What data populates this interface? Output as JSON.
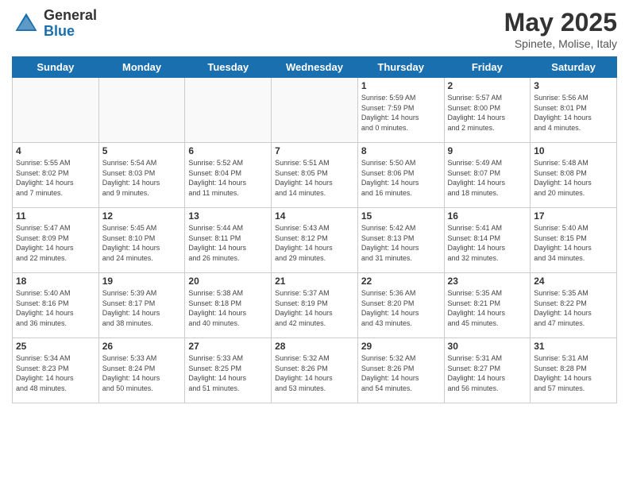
{
  "logo": {
    "general": "General",
    "blue": "Blue"
  },
  "title": "May 2025",
  "subtitle": "Spinete, Molise, Italy",
  "headers": [
    "Sunday",
    "Monday",
    "Tuesday",
    "Wednesday",
    "Thursday",
    "Friday",
    "Saturday"
  ],
  "weeks": [
    [
      {
        "day": "",
        "info": ""
      },
      {
        "day": "",
        "info": ""
      },
      {
        "day": "",
        "info": ""
      },
      {
        "day": "",
        "info": ""
      },
      {
        "day": "1",
        "info": "Sunrise: 5:59 AM\nSunset: 7:59 PM\nDaylight: 14 hours\nand 0 minutes."
      },
      {
        "day": "2",
        "info": "Sunrise: 5:57 AM\nSunset: 8:00 PM\nDaylight: 14 hours\nand 2 minutes."
      },
      {
        "day": "3",
        "info": "Sunrise: 5:56 AM\nSunset: 8:01 PM\nDaylight: 14 hours\nand 4 minutes."
      }
    ],
    [
      {
        "day": "4",
        "info": "Sunrise: 5:55 AM\nSunset: 8:02 PM\nDaylight: 14 hours\nand 7 minutes."
      },
      {
        "day": "5",
        "info": "Sunrise: 5:54 AM\nSunset: 8:03 PM\nDaylight: 14 hours\nand 9 minutes."
      },
      {
        "day": "6",
        "info": "Sunrise: 5:52 AM\nSunset: 8:04 PM\nDaylight: 14 hours\nand 11 minutes."
      },
      {
        "day": "7",
        "info": "Sunrise: 5:51 AM\nSunset: 8:05 PM\nDaylight: 14 hours\nand 14 minutes."
      },
      {
        "day": "8",
        "info": "Sunrise: 5:50 AM\nSunset: 8:06 PM\nDaylight: 14 hours\nand 16 minutes."
      },
      {
        "day": "9",
        "info": "Sunrise: 5:49 AM\nSunset: 8:07 PM\nDaylight: 14 hours\nand 18 minutes."
      },
      {
        "day": "10",
        "info": "Sunrise: 5:48 AM\nSunset: 8:08 PM\nDaylight: 14 hours\nand 20 minutes."
      }
    ],
    [
      {
        "day": "11",
        "info": "Sunrise: 5:47 AM\nSunset: 8:09 PM\nDaylight: 14 hours\nand 22 minutes."
      },
      {
        "day": "12",
        "info": "Sunrise: 5:45 AM\nSunset: 8:10 PM\nDaylight: 14 hours\nand 24 minutes."
      },
      {
        "day": "13",
        "info": "Sunrise: 5:44 AM\nSunset: 8:11 PM\nDaylight: 14 hours\nand 26 minutes."
      },
      {
        "day": "14",
        "info": "Sunrise: 5:43 AM\nSunset: 8:12 PM\nDaylight: 14 hours\nand 29 minutes."
      },
      {
        "day": "15",
        "info": "Sunrise: 5:42 AM\nSunset: 8:13 PM\nDaylight: 14 hours\nand 31 minutes."
      },
      {
        "day": "16",
        "info": "Sunrise: 5:41 AM\nSunset: 8:14 PM\nDaylight: 14 hours\nand 32 minutes."
      },
      {
        "day": "17",
        "info": "Sunrise: 5:40 AM\nSunset: 8:15 PM\nDaylight: 14 hours\nand 34 minutes."
      }
    ],
    [
      {
        "day": "18",
        "info": "Sunrise: 5:40 AM\nSunset: 8:16 PM\nDaylight: 14 hours\nand 36 minutes."
      },
      {
        "day": "19",
        "info": "Sunrise: 5:39 AM\nSunset: 8:17 PM\nDaylight: 14 hours\nand 38 minutes."
      },
      {
        "day": "20",
        "info": "Sunrise: 5:38 AM\nSunset: 8:18 PM\nDaylight: 14 hours\nand 40 minutes."
      },
      {
        "day": "21",
        "info": "Sunrise: 5:37 AM\nSunset: 8:19 PM\nDaylight: 14 hours\nand 42 minutes."
      },
      {
        "day": "22",
        "info": "Sunrise: 5:36 AM\nSunset: 8:20 PM\nDaylight: 14 hours\nand 43 minutes."
      },
      {
        "day": "23",
        "info": "Sunrise: 5:35 AM\nSunset: 8:21 PM\nDaylight: 14 hours\nand 45 minutes."
      },
      {
        "day": "24",
        "info": "Sunrise: 5:35 AM\nSunset: 8:22 PM\nDaylight: 14 hours\nand 47 minutes."
      }
    ],
    [
      {
        "day": "25",
        "info": "Sunrise: 5:34 AM\nSunset: 8:23 PM\nDaylight: 14 hours\nand 48 minutes."
      },
      {
        "day": "26",
        "info": "Sunrise: 5:33 AM\nSunset: 8:24 PM\nDaylight: 14 hours\nand 50 minutes."
      },
      {
        "day": "27",
        "info": "Sunrise: 5:33 AM\nSunset: 8:25 PM\nDaylight: 14 hours\nand 51 minutes."
      },
      {
        "day": "28",
        "info": "Sunrise: 5:32 AM\nSunset: 8:26 PM\nDaylight: 14 hours\nand 53 minutes."
      },
      {
        "day": "29",
        "info": "Sunrise: 5:32 AM\nSunset: 8:26 PM\nDaylight: 14 hours\nand 54 minutes."
      },
      {
        "day": "30",
        "info": "Sunrise: 5:31 AM\nSunset: 8:27 PM\nDaylight: 14 hours\nand 56 minutes."
      },
      {
        "day": "31",
        "info": "Sunrise: 5:31 AM\nSunset: 8:28 PM\nDaylight: 14 hours\nand 57 minutes."
      }
    ]
  ]
}
